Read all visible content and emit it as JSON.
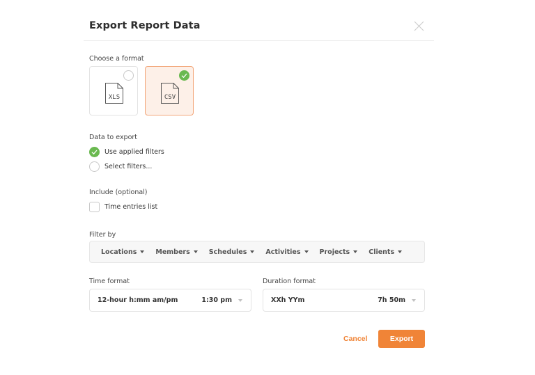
{
  "dialog": {
    "title": "Export Report Data",
    "close_icon": "close-icon"
  },
  "format": {
    "label": "Choose a format",
    "options": [
      {
        "label": "XLS",
        "icon": "file-icon",
        "selected": false
      },
      {
        "label": "CSV",
        "icon": "file-icon",
        "selected": true
      }
    ]
  },
  "data_to_export": {
    "label": "Data to export",
    "options": [
      {
        "label": "Use applied filters",
        "selected": true
      },
      {
        "label": "Select filters...",
        "selected": false
      }
    ]
  },
  "include": {
    "label": "Include (optional)",
    "options": [
      {
        "label": "Time entries list",
        "checked": false
      }
    ]
  },
  "filter_by": {
    "label": "Filter by",
    "items": [
      "Locations",
      "Members",
      "Schedules",
      "Activities",
      "Projects",
      "Clients"
    ]
  },
  "time_format": {
    "label": "Time format",
    "selected": "12-hour h:mm am/pm",
    "example": "1:30 pm"
  },
  "duration_format": {
    "label": "Duration format",
    "selected": "XXh YYm",
    "example": "7h 50m"
  },
  "actions": {
    "cancel_label": "Cancel",
    "export_label": "Export"
  },
  "colors": {
    "accent": "#f08437",
    "selected_card_bg": "#fdf0e8",
    "selected_card_border": "#f2a679",
    "check_green": "#6ab950"
  }
}
